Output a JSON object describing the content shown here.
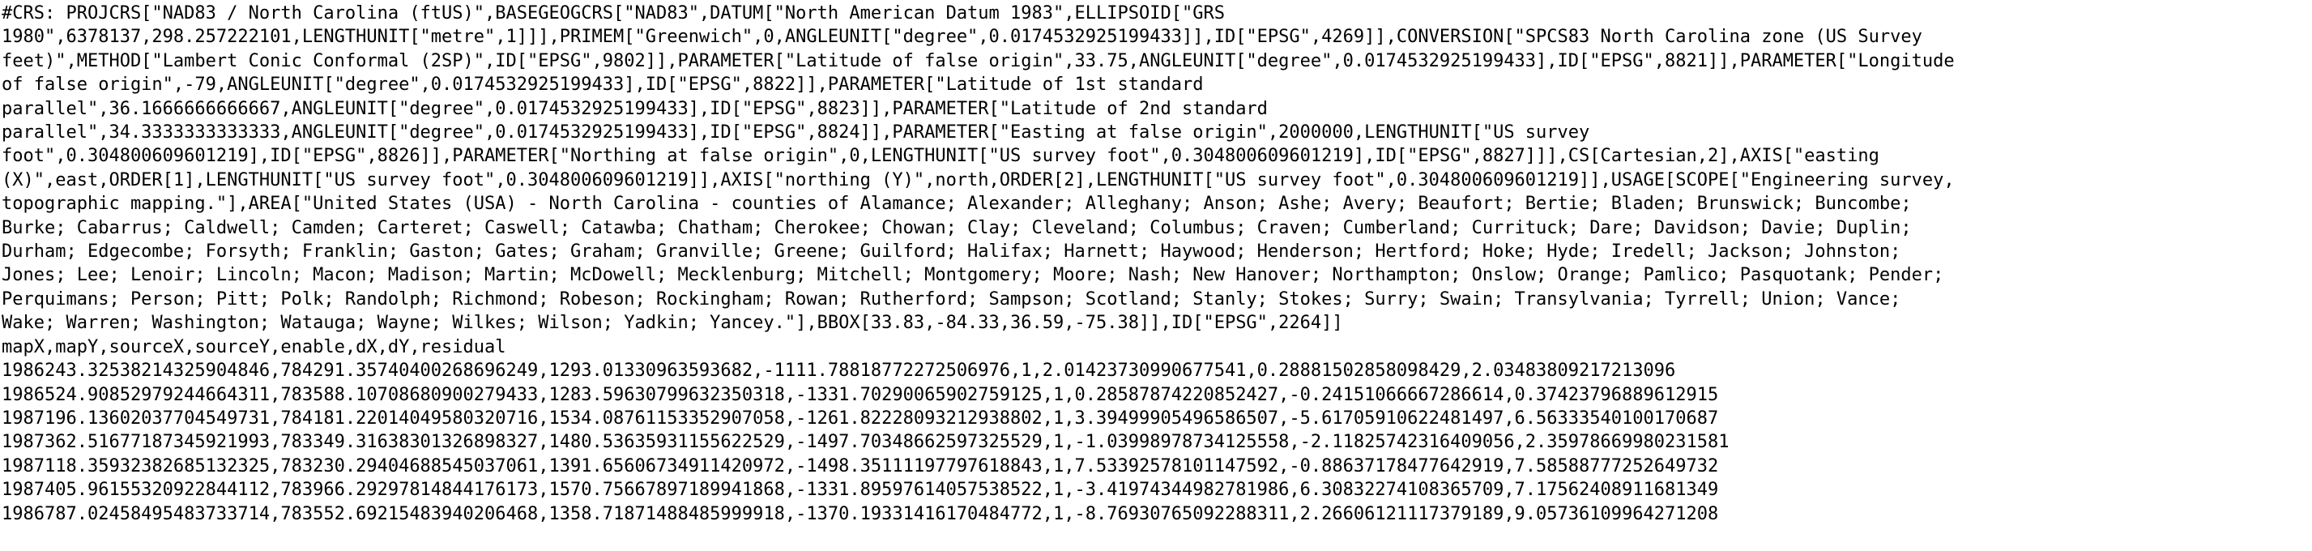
{
  "document": {
    "crs_lines": [
      "#CRS: PROJCRS[\"NAD83 / North Carolina (ftUS)\",BASEGEOGCRS[\"NAD83\",DATUM[\"North American Datum 1983\",ELLIPSOID[\"GRS",
      "1980\",6378137,298.257222101,LENGTHUNIT[\"metre\",1]]],PRIMEM[\"Greenwich\",0,ANGLEUNIT[\"degree\",0.0174532925199433]],ID[\"EPSG\",4269]],CONVERSION[\"SPCS83 North Carolina zone (US Survey",
      "feet)\",METHOD[\"Lambert Conic Conformal (2SP)\",ID[\"EPSG\",9802]],PARAMETER[\"Latitude of false origin\",33.75,ANGLEUNIT[\"degree\",0.0174532925199433],ID[\"EPSG\",8821]],PARAMETER[\"Longitude",
      "of false origin\",-79,ANGLEUNIT[\"degree\",0.0174532925199433],ID[\"EPSG\",8822]],PARAMETER[\"Latitude of 1st standard",
      "parallel\",36.1666666666667,ANGLEUNIT[\"degree\",0.0174532925199433],ID[\"EPSG\",8823]],PARAMETER[\"Latitude of 2nd standard",
      "parallel\",34.3333333333333,ANGLEUNIT[\"degree\",0.0174532925199433],ID[\"EPSG\",8824]],PARAMETER[\"Easting at false origin\",2000000,LENGTHUNIT[\"US survey",
      "foot\",0.304800609601219],ID[\"EPSG\",8826]],PARAMETER[\"Northing at false origin\",0,LENGTHUNIT[\"US survey foot\",0.304800609601219],ID[\"EPSG\",8827]]],CS[Cartesian,2],AXIS[\"easting",
      "(X)\",east,ORDER[1],LENGTHUNIT[\"US survey foot\",0.304800609601219]],AXIS[\"northing (Y)\",north,ORDER[2],LENGTHUNIT[\"US survey foot\",0.304800609601219]],USAGE[SCOPE[\"Engineering survey,",
      "topographic mapping.\"],AREA[\"United States (USA) - North Carolina - counties of Alamance; Alexander; Alleghany; Anson; Ashe; Avery; Beaufort; Bertie; Bladen; Brunswick; Buncombe;",
      "Burke; Cabarrus; Caldwell; Camden; Carteret; Caswell; Catawba; Chatham; Cherokee; Chowan; Clay; Cleveland; Columbus; Craven; Cumberland; Currituck; Dare; Davidson; Davie; Duplin;",
      "Durham; Edgecombe; Forsyth; Franklin; Gaston; Gates; Graham; Granville; Greene; Guilford; Halifax; Harnett; Haywood; Henderson; Hertford; Hoke; Hyde; Iredell; Jackson; Johnston;",
      "Jones; Lee; Lenoir; Lincoln; Macon; Madison; Martin; McDowell; Mecklenburg; Mitchell; Montgomery; Moore; Nash; New Hanover; Northampton; Onslow; Orange; Pamlico; Pasquotank; Pender;",
      "Perquimans; Person; Pitt; Polk; Randolph; Richmond; Robeson; Rockingham; Rowan; Rutherford; Sampson; Scotland; Stanly; Stokes; Surry; Swain; Transylvania; Tyrrell; Union; Vance;",
      "Wake; Warren; Washington; Watauga; Wayne; Wilkes; Wilson; Yadkin; Yancey.\"],BBOX[33.83,-84.33,36.59,-75.38]],ID[\"EPSG\",2264]]"
    ],
    "header": "mapX,mapY,sourceX,sourceY,enable,dX,dY,residual",
    "rows": [
      "1986243.32538214325904846,784291.35740400268696249,1293.01330963593682,-1111.78818772272506976,1,2.01423730990677541,0.28881502858098429,2.03483809217213096",
      "1986524.90852979244664311,783588.10708680900279433,1283.59630799632350318,-1331.70290065902759125,1,0.28587874220852427,-0.24151066667286614,0.37423796889612915",
      "1987196.13602037704549731,784181.22014049580320716,1534.08761153352907058,-1261.82228093212938802,1,3.39499905496586507,-5.61705910622481497,6.56333540100170687",
      "1987362.51677187345921993,783349.31638301326898327,1480.53635931155622529,-1497.70348662597325529,1,-1.03998978734125558,-2.11825742316409056,2.35978669980231581",
      "1987118.35932382685132325,783230.29404688545037061,1391.65606734911420972,-1498.35111197797618843,1,7.53392578101147592,-0.88637178477642919,7.58588777252649732",
      "1987405.96155320922844112,783966.29297814844176173,1570.75667897189941868,-1331.89597614057538522,1,-3.41974344982781986,6.30832274108365709,7.17562408911681349",
      "1986787.02458495483733714,783552.69215483940206468,1358.71871488485999918,-1370.19331416170484772,1,-8.76930765092288311,2.26606121117379189,9.05736109964271208"
    ]
  }
}
